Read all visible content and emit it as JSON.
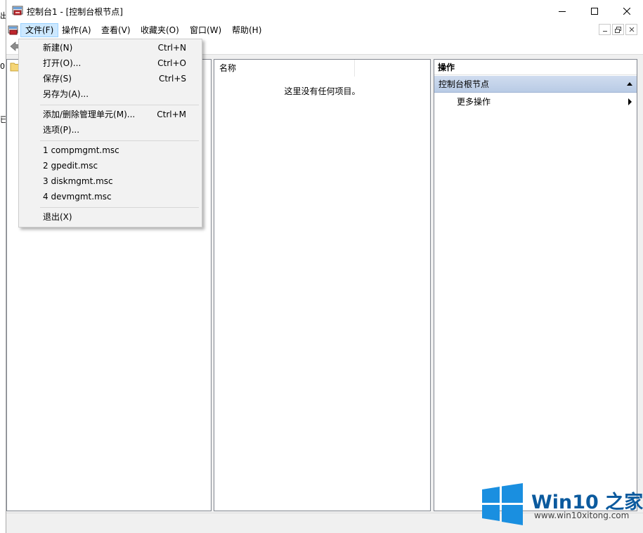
{
  "window": {
    "title": "控制台1 - [控制台根节点]",
    "caption_buttons": {
      "minimize": "minimize-icon",
      "maximize": "maximize-icon",
      "close": "close-icon"
    }
  },
  "desktop_fragments": [
    "出",
    "0",
    "已"
  ],
  "menubar": {
    "items": [
      "文件(F)",
      "操作(A)",
      "查看(V)",
      "收藏夹(O)",
      "窗口(W)",
      "帮助(H)"
    ],
    "active": "文件(F)"
  },
  "file_menu": {
    "items": [
      {
        "label": "新建(N)",
        "shortcut": "Ctrl+N"
      },
      {
        "label": "打开(O)...",
        "shortcut": "Ctrl+O"
      },
      {
        "label": "保存(S)",
        "shortcut": "Ctrl+S"
      },
      {
        "label": "另存为(A)...",
        "shortcut": ""
      },
      {
        "label": "添加/删除管理单元(M)...",
        "shortcut": "Ctrl+M"
      },
      {
        "label": "选项(P)...",
        "shortcut": ""
      },
      {
        "label": "1 compmgmt.msc",
        "shortcut": ""
      },
      {
        "label": "2 gpedit.msc",
        "shortcut": ""
      },
      {
        "label": "3 diskmgmt.msc",
        "shortcut": ""
      },
      {
        "label": "4 devmgmt.msc",
        "shortcut": ""
      },
      {
        "label": "退出(X)",
        "shortcut": ""
      }
    ]
  },
  "center_pane": {
    "column_header": "名称",
    "empty_message": "这里没有任何项目。"
  },
  "actions_pane": {
    "header": "操作",
    "group": "控制台根节点",
    "more": "更多操作"
  },
  "watermark": {
    "brand": "Win10 之家",
    "url": "www.win10xitong.com"
  },
  "colors": {
    "menu_active_bg": "#cce8ff",
    "actions_group_bg": "#c3d3ea",
    "watermark_blue": "#0b5a9e",
    "logo_blue": "#1a8fe0"
  }
}
